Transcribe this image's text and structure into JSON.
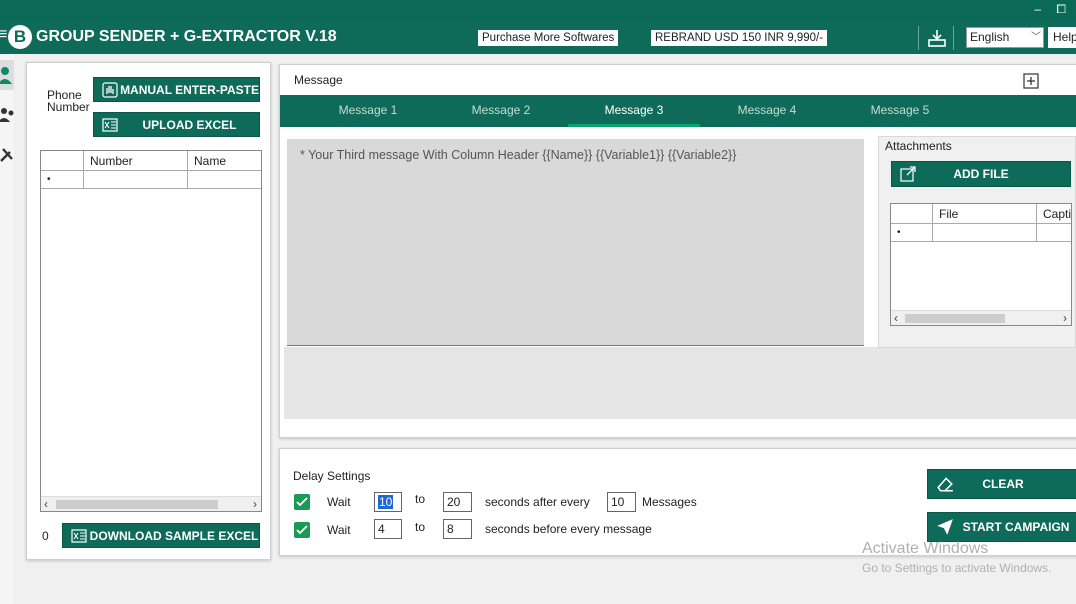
{
  "window": {
    "controls": "– ⧠"
  },
  "header": {
    "menu_glyph": "≡",
    "logo_letter": "B",
    "title": "GROUP SENDER + G-EXTRACTOR V.18",
    "purchase_btn": "Purchase More Softwares",
    "rebrand_btn": "REBRAND USD 150 INR 9,990/-",
    "language": "English",
    "help": "Help"
  },
  "left_panel": {
    "phone_label": "Phone Number",
    "manual_btn": "MANUAL ENTER-PASTE",
    "upload_btn": "UPLOAD EXCEL",
    "columns": [
      "Number",
      "Name"
    ],
    "new_row_marker": "•",
    "count": "0",
    "download_btn": "DOWNLOAD SAMPLE EXCEL"
  },
  "message_panel": {
    "title": "Message",
    "expand_icon": "⊞",
    "tabs": [
      "Message 1",
      "Message 2",
      "Message 3",
      "Message 4",
      "Message 5"
    ],
    "active_tab": "Message 3",
    "placeholder": "* Your Third message With Column Header {{Name}} {{Variable1}} {{Variable2}}"
  },
  "attachments": {
    "title": "Attachments",
    "add_btn": "ADD FILE",
    "columns": [
      "File",
      "Capti"
    ],
    "new_row_marker": "•"
  },
  "delay": {
    "title": "Delay Settings",
    "row1": {
      "wait": "Wait",
      "from": "10",
      "to_label": "to",
      "to": "20",
      "after": "seconds after every",
      "count": "10",
      "unit": "Messages"
    },
    "row2": {
      "wait": "Wait",
      "from": "4",
      "to_label": "to",
      "to": "8",
      "after": "seconds before every message"
    }
  },
  "actions": {
    "clear_btn": "CLEAR",
    "start_btn": "START CAMPAIGN"
  },
  "watermark": {
    "line1": "Activate Windows",
    "line2": "Go to Settings to activate Windows."
  },
  "colors": {
    "brand": "#0e6b59",
    "check": "#1b9a55",
    "tab_indicator": "#0aa56f"
  }
}
